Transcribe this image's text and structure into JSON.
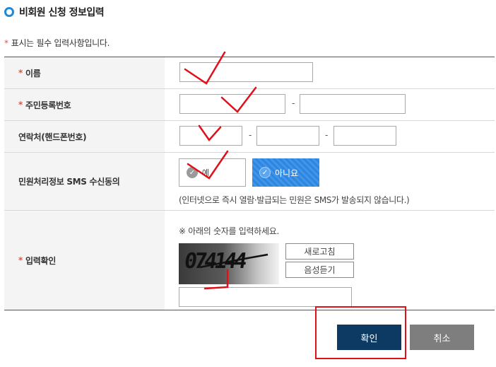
{
  "page": {
    "title": "비회원 신청 정보입력"
  },
  "required_note": {
    "star": "*",
    "text": "표시는 필수 입력사항입니다."
  },
  "form": {
    "name_label": "이름",
    "rrn_label": "주민등록번호",
    "phone_label": "연락처(핸드폰번호)",
    "sms_label": "민원처리정보 SMS 수신동의",
    "captcha_label": "입력확인",
    "dash": "-",
    "sms": {
      "yes_label": "예",
      "no_label": "아니요",
      "selected": "no",
      "note": "(인터넷으로 즉시 열람·발급되는 민원은 SMS가 발송되지 않습니다.)"
    },
    "captcha": {
      "instruction": "※ 아래의 숫자를 입력하세요.",
      "code": "074144",
      "refresh_label": "새로고침",
      "audio_label": "음성듣기"
    }
  },
  "buttons": {
    "confirm": "확인",
    "cancel": "취소"
  },
  "colors": {
    "accent": "#1f8ad8",
    "required": "#e05545",
    "selected_radio": "#2f86e0",
    "confirm_bg": "#0c3a63",
    "cancel_bg": "#7e7e7e",
    "annotation": "#e0101a"
  }
}
